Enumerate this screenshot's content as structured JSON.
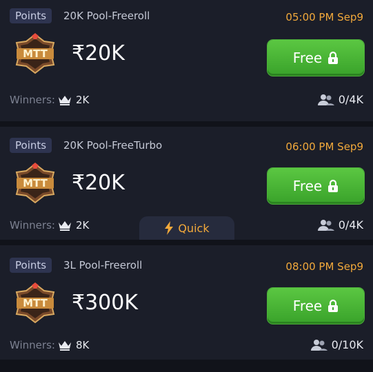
{
  "tournaments": [
    {
      "tag": "Points",
      "pool_name": "20K Pool-Freeroll",
      "time": "05:00 PM Sep9",
      "badge_text": "MTT",
      "prize": "₹20K",
      "button_label": "Free",
      "winners_label": "Winners:",
      "winners_count": "2K",
      "players": "0/4K"
    },
    {
      "tag": "Points",
      "pool_name": "20K Pool-FreeTurbo",
      "time": "06:00 PM Sep9",
      "badge_text": "MTT",
      "prize": "₹20K",
      "button_label": "Free",
      "winners_label": "Winners:",
      "winners_count": "2K",
      "players": "0/4K",
      "quick_label": "Quick"
    },
    {
      "tag": "Points",
      "pool_name": "3L Pool-Freeroll",
      "time": "08:00 PM Sep9",
      "badge_text": "MTT",
      "prize": "₹300K",
      "button_label": "Free",
      "winners_label": "Winners:",
      "winners_count": "8K",
      "players": "0/10K"
    }
  ],
  "colors": {
    "background": "#11131a",
    "card": "#1b1e29",
    "time_orange": "#f2a93b",
    "button_green": "#4cb836",
    "tag_bg": "#2e3450"
  },
  "icons": [
    "mtt-badge-icon",
    "lock-icon",
    "crown-icon",
    "people-icon",
    "lightning-icon"
  ]
}
